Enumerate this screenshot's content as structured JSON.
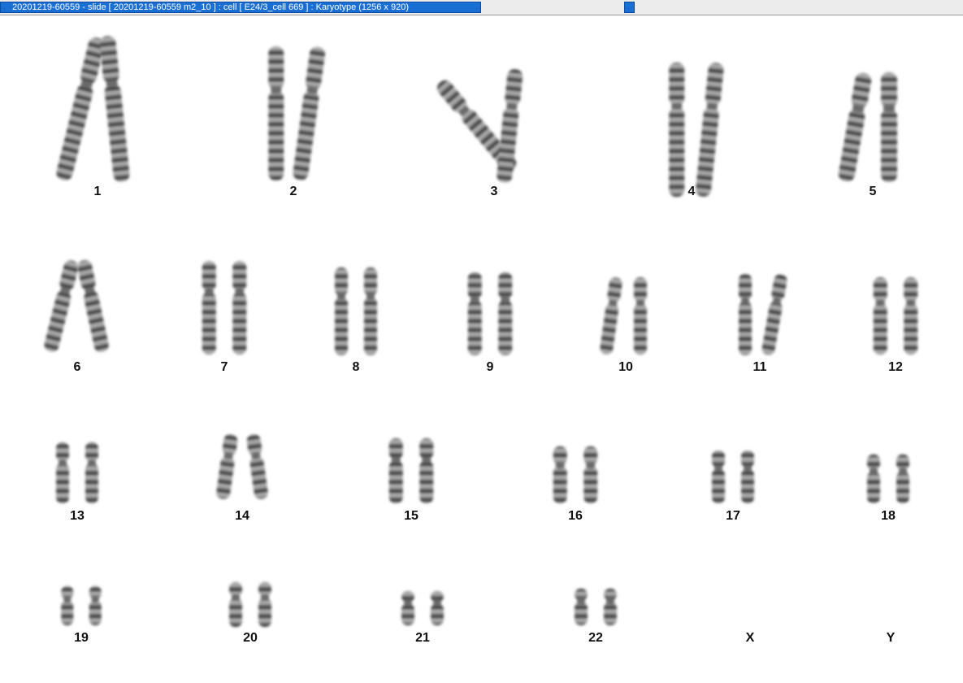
{
  "window": {
    "title": "20201219-60559 - slide [ 20201219-60559 m2_10 ] : cell [ E24/3_cell 669 ] : Karyotype  (1256 x 920)"
  },
  "karyotype": {
    "labels": [
      "1",
      "2",
      "3",
      "4",
      "5",
      "6",
      "7",
      "8",
      "9",
      "10",
      "11",
      "12",
      "13",
      "14",
      "15",
      "16",
      "17",
      "18",
      "19",
      "20",
      "21",
      "22",
      "X",
      "Y"
    ]
  }
}
